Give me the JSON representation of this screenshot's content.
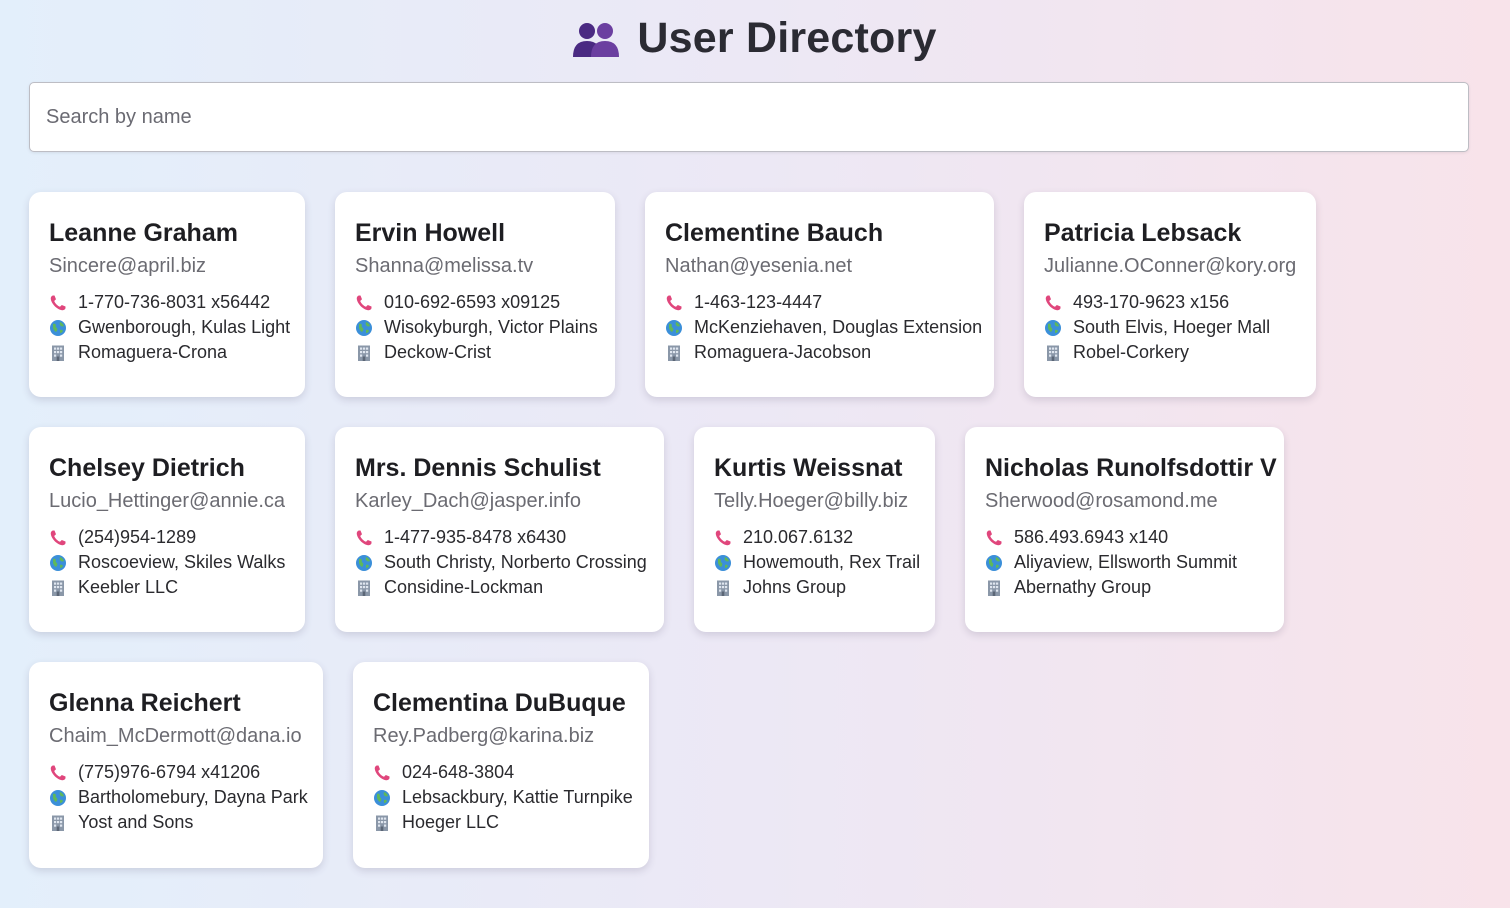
{
  "header": {
    "title": "User Directory",
    "icon": "people-icon"
  },
  "search": {
    "placeholder": "Search by name",
    "value": ""
  },
  "colors": {
    "phone_icon": "#e0467c",
    "globe_icon": "#3b8fd9",
    "building_icon": "#8a97a8",
    "people_icon": "#6b3fa0"
  },
  "users": [
    {
      "name": "Leanne Graham",
      "email": "Sincere@april.biz",
      "phone": "1-770-736-8031 x56442",
      "address": "Gwenborough, Kulas Light",
      "company": "Romaguera-Crona"
    },
    {
      "name": "Ervin Howell",
      "email": "Shanna@melissa.tv",
      "phone": "010-692-6593 x09125",
      "address": "Wisokyburgh, Victor Plains",
      "company": "Deckow-Crist"
    },
    {
      "name": "Clementine Bauch",
      "email": "Nathan@yesenia.net",
      "phone": "1-463-123-4447",
      "address": "McKenziehaven, Douglas Extension",
      "company": "Romaguera-Jacobson"
    },
    {
      "name": "Patricia Lebsack",
      "email": "Julianne.OConner@kory.org",
      "phone": "493-170-9623 x156",
      "address": "South Elvis, Hoeger Mall",
      "company": "Robel-Corkery"
    },
    {
      "name": "Chelsey Dietrich",
      "email": "Lucio_Hettinger@annie.ca",
      "phone": "(254)954-1289",
      "address": "Roscoeview, Skiles Walks",
      "company": "Keebler LLC"
    },
    {
      "name": "Mrs. Dennis Schulist",
      "email": "Karley_Dach@jasper.info",
      "phone": "1-477-935-8478 x6430",
      "address": "South Christy, Norberto Crossing",
      "company": "Considine-Lockman"
    },
    {
      "name": "Kurtis Weissnat",
      "email": "Telly.Hoeger@billy.biz",
      "phone": "210.067.6132",
      "address": "Howemouth, Rex Trail",
      "company": "Johns Group"
    },
    {
      "name": "Nicholas Runolfsdottir V",
      "email": "Sherwood@rosamond.me",
      "phone": "586.493.6943 x140",
      "address": "Aliyaview, Ellsworth Summit",
      "company": "Abernathy Group"
    },
    {
      "name": "Glenna Reichert",
      "email": "Chaim_McDermott@dana.io",
      "phone": "(775)976-6794 x41206",
      "address": "Bartholomebury, Dayna Park",
      "company": "Yost and Sons"
    },
    {
      "name": "Clementina DuBuque",
      "email": "Rey.Padberg@karina.biz",
      "phone": "024-648-3804",
      "address": "Lebsackbury, Kattie Turnpike",
      "company": "Hoeger LLC"
    }
  ]
}
